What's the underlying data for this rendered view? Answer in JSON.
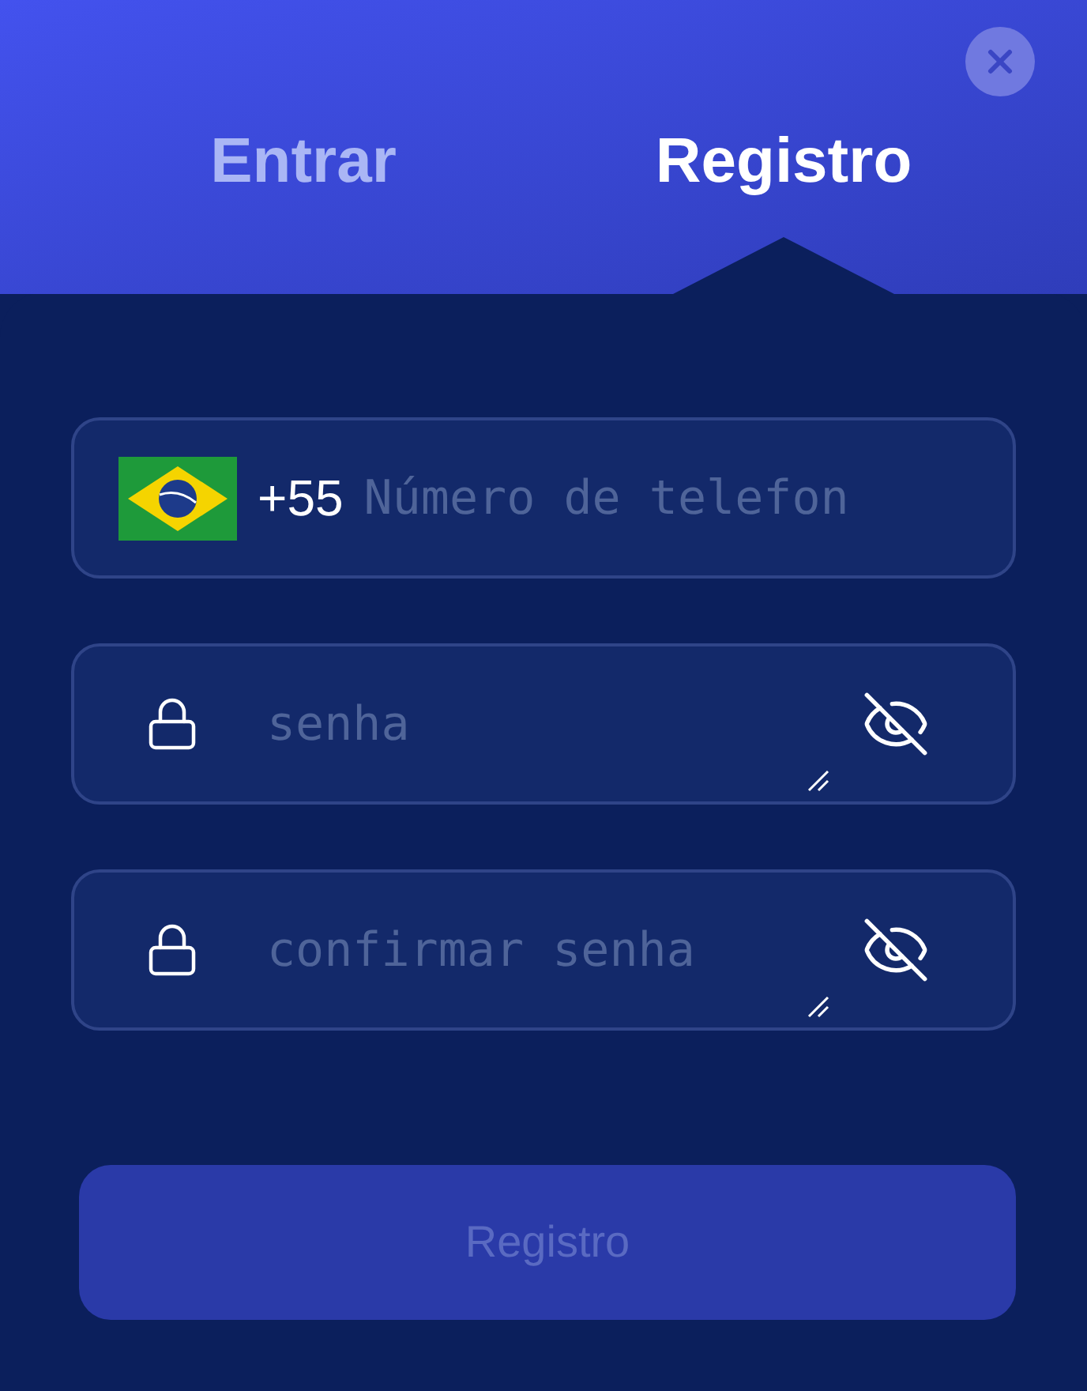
{
  "tabs": [
    {
      "label": "Entrar",
      "selected": false
    },
    {
      "label": "Registro",
      "selected": true
    }
  ],
  "phone": {
    "country_code": "+55",
    "placeholder": "Número de telefon"
  },
  "password_fields": [
    {
      "placeholder": "senha",
      "show_password": false
    },
    {
      "placeholder": "confirmar senha",
      "show_password": false
    }
  ],
  "submit": {
    "label": "Registro",
    "disabled": true
  }
}
